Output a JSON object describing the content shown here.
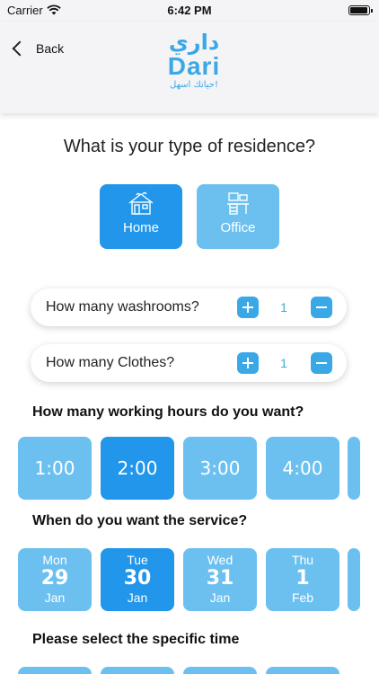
{
  "status_bar": {
    "carrier": "Carrier",
    "time": "6:42 PM"
  },
  "header": {
    "back_label": "Back",
    "logo_arabic": "داري",
    "logo_name": "Dari",
    "logo_tagline": "حياتك اسهل!"
  },
  "residence": {
    "question": "What is your type of residence?",
    "options": [
      {
        "label": "Home",
        "icon": "house-icon",
        "selected": true
      },
      {
        "label": "Office",
        "icon": "office-desk-icon",
        "selected": false
      }
    ]
  },
  "counters": [
    {
      "label": "How many washrooms?",
      "value": "1"
    },
    {
      "label": "How many Clothes?",
      "value": "1"
    }
  ],
  "hours": {
    "label": "How many working hours do you want?",
    "options": [
      "1:00",
      "2:00",
      "3:00",
      "4:00"
    ],
    "selected": "2:00"
  },
  "service_date": {
    "label": "When do you want the service?",
    "dates": [
      {
        "dow": "Mon",
        "day": "29",
        "month": "Jan"
      },
      {
        "dow": "Tue",
        "day": "30",
        "month": "Jan"
      },
      {
        "dow": "Wed",
        "day": "31",
        "month": "Jan"
      },
      {
        "dow": "Thu",
        "day": "1",
        "month": "Feb"
      }
    ],
    "selected_index": 1
  },
  "specific_time": {
    "label": "Please select the specific time"
  },
  "colors": {
    "primary": "#2296ea",
    "light": "#6cc0f0",
    "accent": "#3aa8e6",
    "header_bg": "#f4f4f6"
  }
}
